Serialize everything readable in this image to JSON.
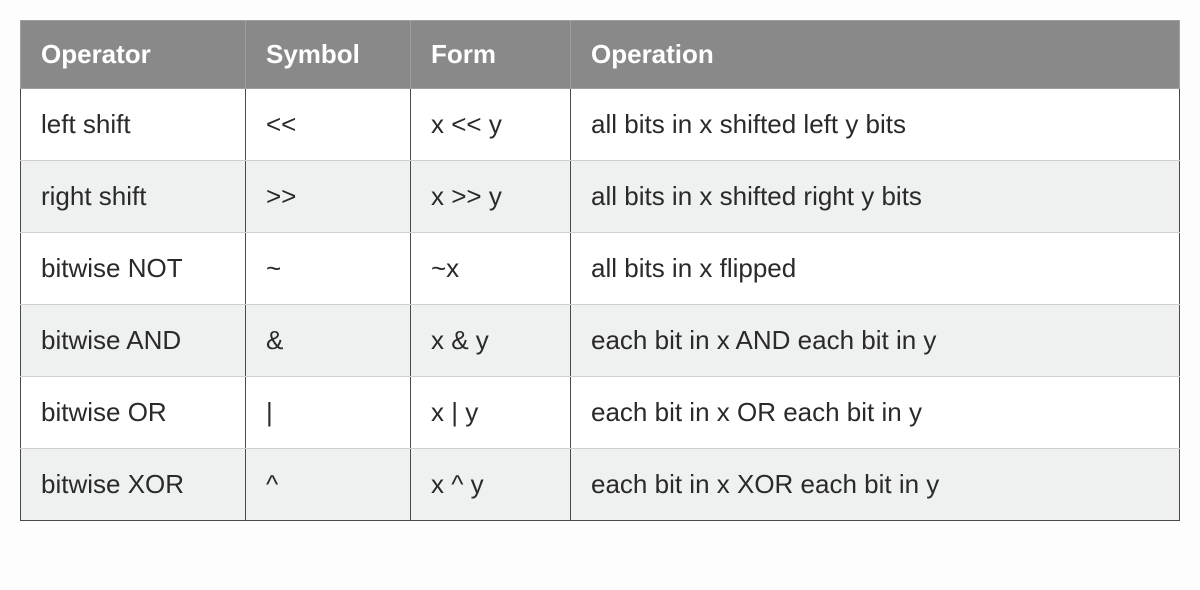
{
  "chart_data": {
    "type": "table",
    "title": "",
    "columns": [
      "Operator",
      "Symbol",
      "Form",
      "Operation"
    ],
    "rows": [
      [
        "left shift",
        "<<",
        "x << y",
        "all bits in x shifted left y bits"
      ],
      [
        "right shift",
        ">>",
        "x >> y",
        "all bits in x shifted right y bits"
      ],
      [
        "bitwise NOT",
        "~",
        "~x",
        "all bits in x flipped"
      ],
      [
        "bitwise AND",
        "&",
        "x & y",
        "each bit in x AND each bit in y"
      ],
      [
        "bitwise OR",
        "|",
        "x | y",
        "each bit in x OR each bit in y"
      ],
      [
        "bitwise XOR",
        "^",
        "x ^ y",
        "each bit in x XOR each bit in y"
      ]
    ]
  },
  "headers": {
    "operator": "Operator",
    "symbol": "Symbol",
    "form": "Form",
    "operation": "Operation"
  },
  "rows": [
    {
      "operator": "left shift",
      "symbol": "<<",
      "form": "x << y",
      "operation": "all bits in x shifted left y bits"
    },
    {
      "operator": "right shift",
      "symbol": ">>",
      "form": "x >> y",
      "operation": "all bits in x shifted right y bits"
    },
    {
      "operator": "bitwise NOT",
      "symbol": "~",
      "form": "~x",
      "operation": "all bits in x flipped"
    },
    {
      "operator": "bitwise AND",
      "symbol": "&",
      "form": "x & y",
      "operation": "each bit in x AND each bit in y"
    },
    {
      "operator": "bitwise OR",
      "symbol": "|",
      "form": "x | y",
      "operation": "each bit in x OR each bit in y"
    },
    {
      "operator": "bitwise XOR",
      "symbol": "^",
      "form": "x ^ y",
      "operation": "each bit in x XOR each bit in y"
    }
  ]
}
